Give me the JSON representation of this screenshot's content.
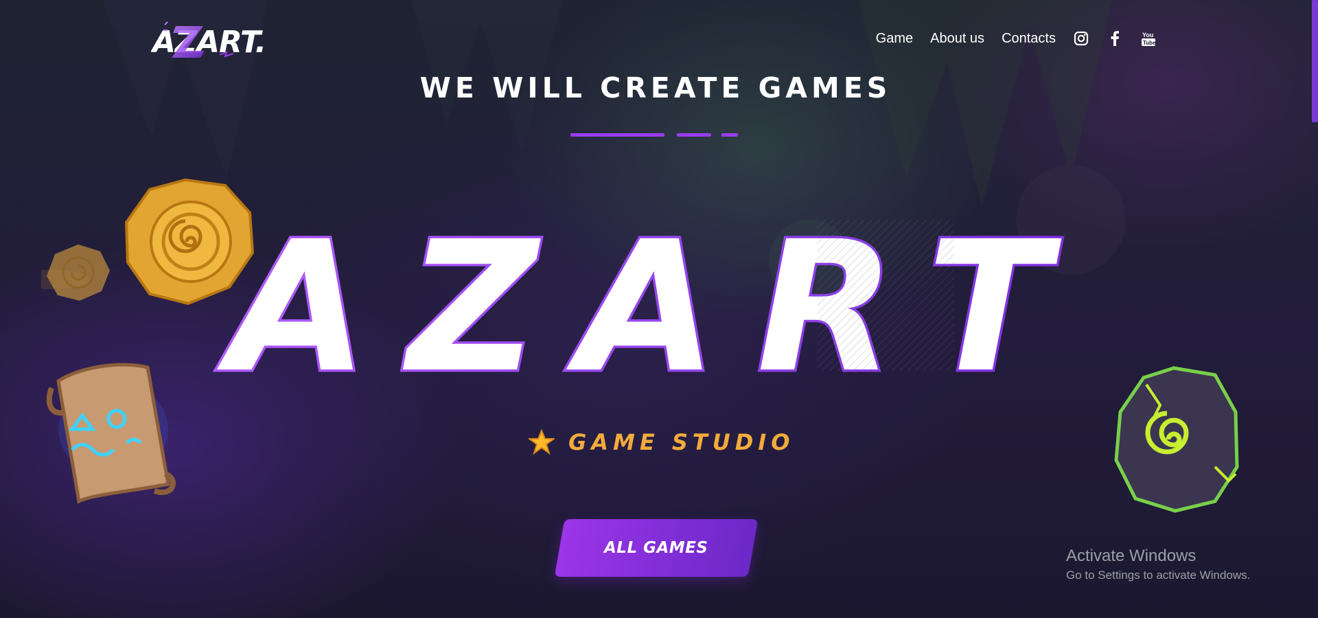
{
  "brand": {
    "logo_text": "AZART."
  },
  "nav": {
    "items": [
      {
        "label": "Game"
      },
      {
        "label": "About us"
      },
      {
        "label": "Contacts"
      }
    ],
    "social": [
      "instagram-icon",
      "facebook-icon",
      "youtube-icon"
    ]
  },
  "hero": {
    "headline": "WE WILL CREATE GAMES",
    "big_word": "AZART",
    "subtitle": "GAME STUDIO",
    "cta": "ALL GAMES"
  },
  "os_overlay": {
    "title": "Activate Windows",
    "subtitle": "Go to Settings to activate Windows."
  },
  "colors": {
    "accent": "#9a3df0",
    "gold": "#f2ab3c",
    "text": "#ffffff",
    "background": "#1d1a33"
  }
}
